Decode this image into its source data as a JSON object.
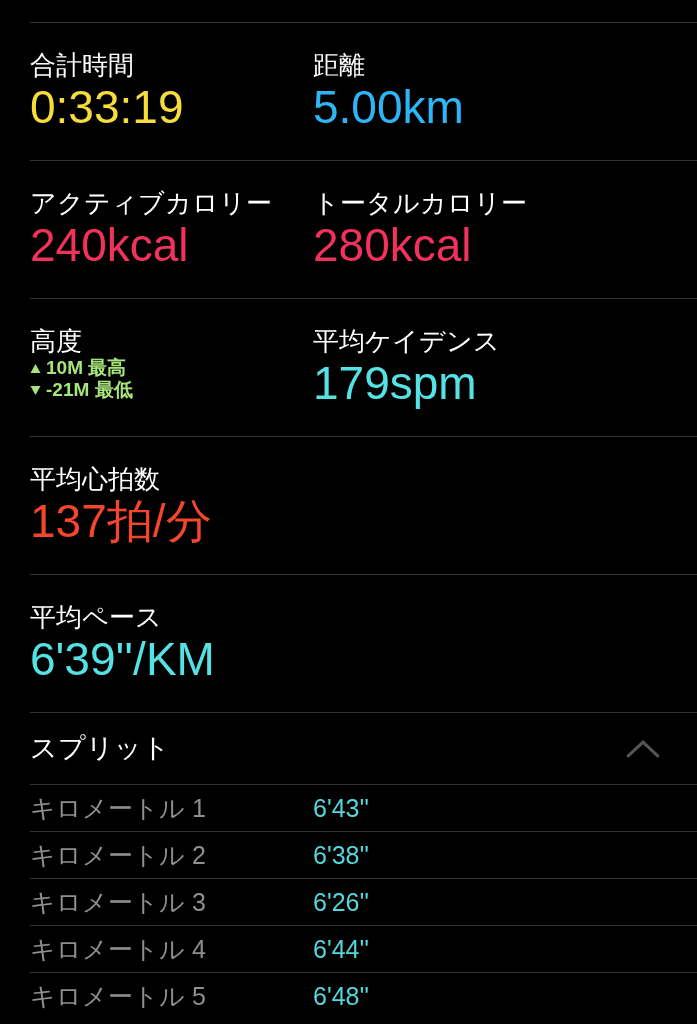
{
  "metrics": [
    {
      "kind": "pair",
      "items": [
        {
          "label": "合計時間",
          "value": "0:33:19",
          "color": "#f7dd3b"
        },
        {
          "label": "距離",
          "value": "5.00km",
          "color": "#2fb5f6"
        }
      ]
    },
    {
      "kind": "pair",
      "items": [
        {
          "label": "アクティブカロリー",
          "value": "240kcal",
          "color": "#f2325c"
        },
        {
          "label": "トータルカロリー",
          "value": "280kcal",
          "color": "#f2325c"
        }
      ]
    },
    {
      "kind": "pair",
      "items": [
        {
          "label": "高度",
          "kind": "elevation",
          "color": "#a7e47a",
          "lines": [
            {
              "kind": "up",
              "amount": "10M",
              "caption": "最高"
            },
            {
              "kind": "down",
              "amount": "-21M",
              "caption": "最低"
            }
          ]
        },
        {
          "label": "平均ケイデンス",
          "value": "179spm",
          "color": "#55e2e4"
        }
      ]
    },
    {
      "kind": "single",
      "items": [
        {
          "label": "平均心拍数",
          "value": "137拍/分",
          "color": "#f4462d"
        }
      ]
    },
    {
      "kind": "single",
      "items": [
        {
          "label": "平均ペース",
          "value": "6'39''/KM",
          "color": "#55e2e4"
        }
      ]
    }
  ],
  "splits": {
    "title": "スプリット",
    "expanded": true,
    "rows": [
      {
        "label": "キロメートル 1",
        "value": "6'43''"
      },
      {
        "label": "キロメートル 2",
        "value": "6'38''"
      },
      {
        "label": "キロメートル 3",
        "value": "6'26''"
      },
      {
        "label": "キロメートル 4",
        "value": "6'44''"
      },
      {
        "label": "キロメートル 5",
        "value": "6'48''"
      }
    ]
  }
}
